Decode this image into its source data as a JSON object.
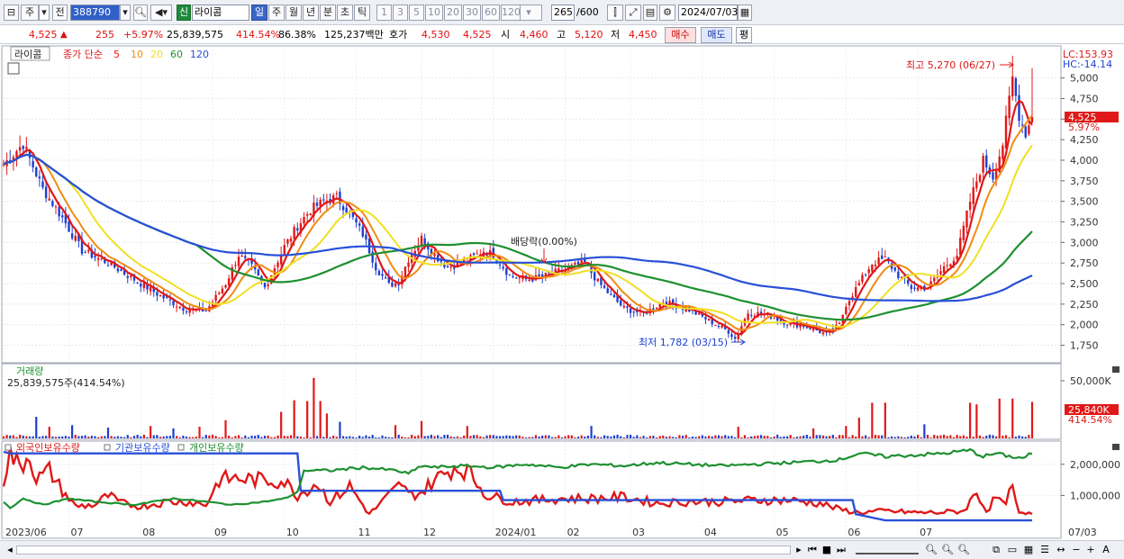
{
  "toolbar": {
    "type_label": "주",
    "all_label": "전",
    "code": "388790",
    "badge": "신",
    "name": "라이콤",
    "periods": [
      "일",
      "주",
      "월",
      "년",
      "분",
      "초",
      "틱"
    ],
    "nums": [
      "1",
      "3",
      "5",
      "10",
      "20",
      "30",
      "60",
      "120"
    ],
    "count": "265",
    "count_total": "/600",
    "date": "2024/07/03"
  },
  "quote": {
    "price": "4,525",
    "arrow": "▲",
    "change": "255",
    "change_pct": "+5.97%",
    "volume": "25,839,575",
    "vol_ratio": "414.54%",
    "turnover": "86.38%",
    "amount": "125,237백만",
    "hoga_label": "호가",
    "hoga1": "4,530",
    "hoga2": "4,525",
    "open_label": "시",
    "open": "4,460",
    "high_label": "고",
    "high": "5,120",
    "low_label": "저",
    "low": "4,450",
    "buy": "매수",
    "sell": "매도",
    "avg": "평"
  },
  "legend": {
    "name": "라이콤",
    "ma_label": "종가 단순",
    "ma": [
      "5",
      "10",
      "20",
      "60",
      "120"
    ],
    "ma_colors": [
      "#e01818",
      "#f08c14",
      "#f0e020",
      "#1e9030",
      "#2850d8"
    ]
  },
  "price_panel": {
    "lc": "LC:153.93",
    "hc": "HC:-14.14",
    "last_price": "4,525",
    "last_pct": "5.97%",
    "high_note": "최고 5,270 (06/27)",
    "low_note": "최저 1,782 (03/15)",
    "event_note": "배당락(0.00%)"
  },
  "volume_panel": {
    "title": "거래량",
    "value": "25,839,575주(414.54%)",
    "axis_top": "50,000K",
    "last": "25,840K",
    "last_pct": "414.54%"
  },
  "holding_panel": {
    "legend": [
      "외국인보유수량",
      "기관보유수량",
      "개인보유수량"
    ],
    "legend_colors": [
      "#e01818",
      "#2850d8",
      "#1e9030"
    ],
    "ticks": [
      "2,000,000",
      "1,000,000"
    ]
  },
  "x_labels": [
    "2023/06",
    "07",
    "08",
    "09",
    "10",
    "11",
    "12",
    "2024/01",
    "02",
    "03",
    "04",
    "05",
    "06",
    "07"
  ],
  "x_right_label": "07/03",
  "chart_data": [
    {
      "type": "candlestick",
      "title": "",
      "y_ticks": [
        5000,
        4750,
        4500,
        4250,
        4000,
        3750,
        3500,
        3250,
        3000,
        2750,
        2500,
        2250,
        2000,
        1750
      ],
      "ylim": [
        1570,
        5390
      ],
      "anchors_close": [
        [
          0,
          3950
        ],
        [
          6,
          4200
        ],
        [
          12,
          3650
        ],
        [
          18,
          3300
        ],
        [
          24,
          2900
        ],
        [
          32,
          2750
        ],
        [
          38,
          2600
        ],
        [
          42,
          2500
        ],
        [
          48,
          2350
        ],
        [
          55,
          2200
        ],
        [
          62,
          2170
        ],
        [
          68,
          2500
        ],
        [
          72,
          2850
        ],
        [
          76,
          2700
        ],
        [
          80,
          2450
        ],
        [
          86,
          2950
        ],
        [
          90,
          3200
        ],
        [
          94,
          3400
        ],
        [
          98,
          3500
        ],
        [
          102,
          3550
        ],
        [
          106,
          3350
        ],
        [
          110,
          3100
        ],
        [
          114,
          2700
        ],
        [
          118,
          2480
        ],
        [
          121,
          2520
        ],
        [
          124,
          2800
        ],
        [
          128,
          3050
        ],
        [
          132,
          2850
        ],
        [
          136,
          2700
        ],
        [
          142,
          2780
        ],
        [
          147,
          2900
        ],
        [
          150,
          2850
        ],
        [
          155,
          2600
        ],
        [
          160,
          2550
        ],
        [
          165,
          2580
        ],
        [
          170,
          2650
        ],
        [
          174,
          2700
        ],
        [
          178,
          2750
        ],
        [
          182,
          2520
        ],
        [
          186,
          2350
        ],
        [
          190,
          2200
        ],
        [
          196,
          2130
        ],
        [
          202,
          2280
        ],
        [
          210,
          2180
        ],
        [
          216,
          2050
        ],
        [
          222,
          1920
        ],
        [
          224,
          1830
        ],
        [
          228,
          2150
        ],
        [
          234,
          2120
        ],
        [
          240,
          2020
        ],
        [
          246,
          1980
        ],
        [
          252,
          1880
        ],
        [
          256,
          2000
        ],
        [
          258,
          2250
        ],
        [
          262,
          2500
        ],
        [
          266,
          2750
        ],
        [
          270,
          2800
        ],
        [
          274,
          2600
        ],
        [
          278,
          2450
        ],
        [
          283,
          2450
        ],
        [
          288,
          2700
        ],
        [
          292,
          2850
        ],
        [
          296,
          3500
        ],
        [
          300,
          4000
        ],
        [
          303,
          3800
        ],
        [
          306,
          4200
        ],
        [
          309,
          5000
        ],
        [
          311,
          4550
        ],
        [
          313,
          4330
        ],
        [
          315,
          4525
        ]
      ],
      "ma_periods": [
        5,
        10,
        20,
        60,
        120
      ]
    },
    {
      "type": "bar",
      "title": "거래량",
      "spikes": [
        [
          10,
          2.6
        ],
        [
          14,
          1.4
        ],
        [
          21,
          1.6
        ],
        [
          32,
          1.3
        ],
        [
          45,
          1.5
        ],
        [
          52,
          1.2
        ],
        [
          60,
          1.4
        ],
        [
          68,
          2.2
        ],
        [
          85,
          3.2
        ],
        [
          89,
          4.6
        ],
        [
          93,
          4.5
        ],
        [
          95,
          7.3
        ],
        [
          97,
          4.5
        ],
        [
          99,
          3.0
        ],
        [
          103,
          2.0
        ],
        [
          120,
          1.6
        ],
        [
          128,
          2.1
        ],
        [
          142,
          1.5
        ],
        [
          180,
          1.5
        ],
        [
          225,
          1.4
        ],
        [
          248,
          1.2
        ],
        [
          258,
          1.5
        ],
        [
          262,
          2.5
        ],
        [
          266,
          4.3
        ],
        [
          270,
          4.3
        ],
        [
          282,
          1.7
        ],
        [
          296,
          4.3
        ],
        [
          298,
          4.1
        ],
        [
          305,
          4.8
        ],
        [
          309,
          4.8
        ],
        [
          315,
          4.4
        ]
      ],
      "max": 7.6,
      "unit_label": "50,000K"
    },
    {
      "type": "line",
      "title": "",
      "series": [
        {
          "name": "외국인보유수량",
          "anchors": [
            [
              0,
              1500000
            ],
            [
              2,
              2350000
            ],
            [
              5,
              1900000
            ],
            [
              8,
              2350000
            ],
            [
              10,
              1500000
            ],
            [
              14,
              1800000
            ],
            [
              18,
              1150000
            ],
            [
              22,
              650000
            ],
            [
              28,
              700000
            ],
            [
              32,
              1000000
            ],
            [
              36,
              750000
            ],
            [
              42,
              650000
            ],
            [
              50,
              800000
            ],
            [
              56,
              800000
            ],
            [
              62,
              700000
            ],
            [
              66,
              1500000
            ],
            [
              70,
              1550000
            ],
            [
              78,
              1500000
            ],
            [
              86,
              1450000
            ],
            [
              90,
              1000000
            ],
            [
              96,
              1400000
            ],
            [
              100,
              800000
            ],
            [
              106,
              1300000
            ],
            [
              112,
              400000
            ],
            [
              118,
              1000000
            ],
            [
              122,
              1400000
            ],
            [
              124,
              1000000
            ],
            [
              128,
              1100000
            ],
            [
              132,
              1500000
            ],
            [
              138,
              1900000
            ],
            [
              142,
              1800000
            ],
            [
              148,
              1000000
            ],
            [
              156,
              800000
            ],
            [
              164,
              850000
            ],
            [
              170,
              900000
            ],
            [
              180,
              900000
            ],
            [
              190,
              950000
            ],
            [
              200,
              750000
            ],
            [
              210,
              800000
            ],
            [
              220,
              800000
            ],
            [
              230,
              850000
            ],
            [
              240,
              850000
            ],
            [
              250,
              750000
            ],
            [
              256,
              550000
            ],
            [
              262,
              450000
            ],
            [
              270,
              500000
            ],
            [
              280,
              450000
            ],
            [
              286,
              450000
            ],
            [
              294,
              500000
            ],
            [
              298,
              1100000
            ],
            [
              301,
              500000
            ],
            [
              304,
              950000
            ],
            [
              306,
              700000
            ],
            [
              309,
              1200000
            ],
            [
              311,
              400000
            ],
            [
              315,
              400000
            ]
          ]
        },
        {
          "name": "기관보유수량",
          "anchors": [
            [
              0,
              2400000
            ],
            [
              2,
              2350000
            ],
            [
              60,
              2350000
            ],
            [
              90,
              2350000
            ],
            [
              91,
              1150000
            ],
            [
              152,
              1150000
            ],
            [
              153,
              850000
            ],
            [
              260,
              850000
            ],
            [
              261,
              400000
            ],
            [
              270,
              200000
            ],
            [
              315,
              200000
            ]
          ]
        },
        {
          "name": "개인보유수량",
          "anchors": [
            [
              0,
              800000
            ],
            [
              2,
              600000
            ],
            [
              6,
              900000
            ],
            [
              12,
              700000
            ],
            [
              20,
              900000
            ],
            [
              28,
              800000
            ],
            [
              40,
              700000
            ],
            [
              52,
              900000
            ],
            [
              62,
              800000
            ],
            [
              70,
              700000
            ],
            [
              80,
              800000
            ],
            [
              86,
              900000
            ],
            [
              90,
              1100000
            ],
            [
              92,
              1800000
            ],
            [
              100,
              1800000
            ],
            [
              110,
              1900000
            ],
            [
              120,
              1800000
            ],
            [
              124,
              1700000
            ],
            [
              128,
              1950000
            ],
            [
              132,
              1900000
            ],
            [
              140,
              1950000
            ],
            [
              150,
              1900000
            ],
            [
              160,
              2000000
            ],
            [
              170,
              1900000
            ],
            [
              180,
              2000000
            ],
            [
              190,
              1950000
            ],
            [
              200,
              2050000
            ],
            [
              210,
              2000000
            ],
            [
              220,
              1950000
            ],
            [
              230,
              2000000
            ],
            [
              240,
              2050000
            ],
            [
              250,
              2100000
            ],
            [
              256,
              2150000
            ],
            [
              262,
              2350000
            ],
            [
              270,
              2250000
            ],
            [
              280,
              2300000
            ],
            [
              288,
              2350000
            ],
            [
              296,
              2450000
            ],
            [
              300,
              2250000
            ],
            [
              304,
              2350000
            ],
            [
              308,
              2250000
            ],
            [
              312,
              2200000
            ],
            [
              315,
              2350000
            ]
          ]
        }
      ],
      "y_ticks": [
        2000000,
        1000000
      ],
      "ylim": [
        0,
        2600000
      ]
    }
  ]
}
